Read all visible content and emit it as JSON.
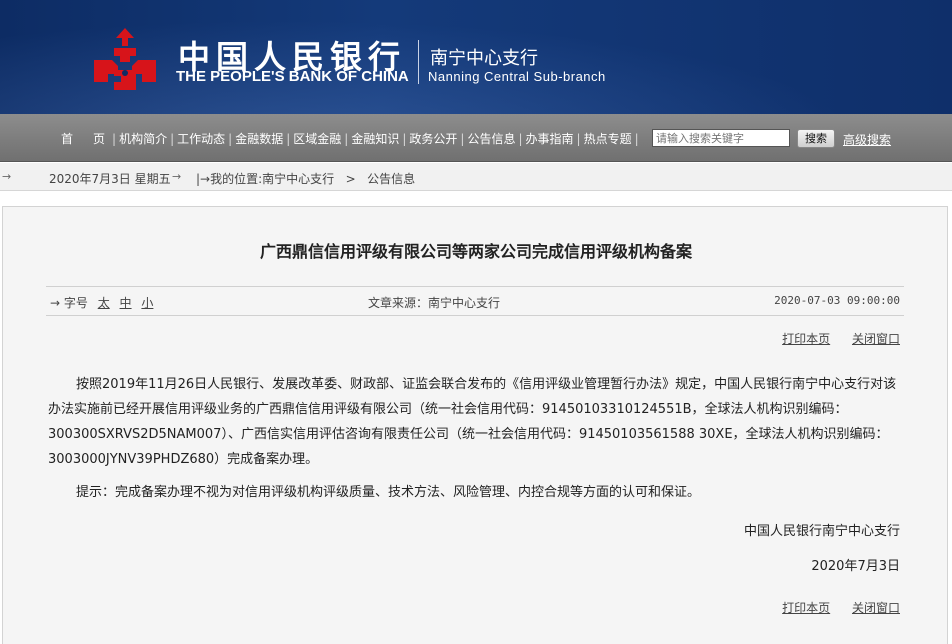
{
  "header": {
    "brand_cn": "中国人民银行",
    "brand_en": "THE PEOPLE'S BANK OF CHINA",
    "branch_cn": "南宁中心支行",
    "branch_en": "Nanning  Central  Sub-branch",
    "emblem_icon": "pboc-emblem-icon",
    "emblem_color": "#d7141a"
  },
  "nav": {
    "items": [
      "首页",
      "机构简介",
      "工作动态",
      "金融数据",
      "区域金融",
      "金融知识",
      "政务公开",
      "公告信息",
      "办事指南",
      "热点专题"
    ],
    "search_placeholder": "请输入搜索关键字",
    "search_button": "搜索",
    "advanced_search": "高级搜索"
  },
  "breadcrumb": {
    "arrow": "→",
    "date": "2020年7月3日  星期五",
    "arrow2": "→",
    "prefix": "|→我的位置:",
    "site": "南宁中心支行",
    "sep": ">",
    "section": "公告信息"
  },
  "article": {
    "title": "广西鼎信信用评级有限公司等两家公司完成信用评级机构备案",
    "font_size_label": "→ 字号",
    "size_large": "太",
    "size_medium": "中",
    "size_small": "小",
    "source": "文章来源：南宁中心支行",
    "publish_time": "2020-07-03  09:00:00",
    "print": "打印本页",
    "close": "关闭窗口",
    "paragraph1": "按照2019年11月26日人民银行、发展改革委、财政部、证监会联合发布的《信用评级业管理暂行办法》规定，中国人民银行南宁中心支行对该办法实施前已经开展信用评级业务的广西鼎信信用评级有限公司（统一社会信用代码：91450103310124551B，全球法人机构识别编码：300300SXRVS2D5NAM007）、广西信实信用评估咨询有限责任公司（统一社会信用代码：91450103561588 30XE，全球法人机构识别编码：3003000JYNV39PHDZ680）完成备案办理。",
    "paragraph2": "提示：完成备案办理不视为对信用评级机构评级质量、技术方法、风险管理、内控合规等方面的认可和保证。",
    "signature": "中国人民银行南宁中心支行",
    "sign_date": "2020年7月3日"
  }
}
